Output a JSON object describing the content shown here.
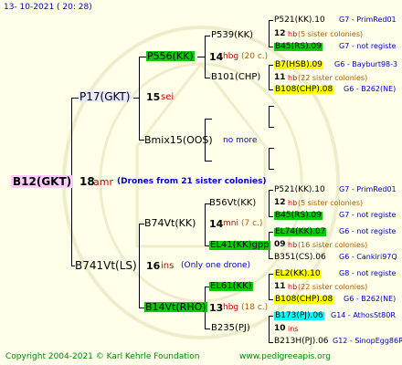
{
  "header": {
    "timestamp": "13- 10-2021 ( 20: 28)"
  },
  "footer": {
    "copyright": "Copyright 2004-2021 © Karl Kehrle Foundation",
    "site": "www.pedigreeapis.org"
  },
  "root": {
    "id": "B12(GKT)",
    "num": "18",
    "abbr": "amr",
    "note": "(Drones from 21 sister colonies)"
  },
  "p1": {
    "id": "P17(GKT)",
    "num": "15",
    "abbr": "sei"
  },
  "p2": {
    "id": "B741Vt(LS)",
    "num": "16",
    "abbr": "ins",
    "note": "(Only one drone)"
  },
  "g11": {
    "id": "P556(KK)",
    "num": "14",
    "abbr": "hbg",
    "extra": "(20 c.)"
  },
  "g12": {
    "id": "Bmix15(OOS)",
    "note": "no more"
  },
  "g21": {
    "id": "B74Vt(KK)",
    "num": "14",
    "abbr": "mni",
    "extra": "(7 c.)"
  },
  "g22": {
    "id": "B14Vt(RHO)",
    "num": "13",
    "abbr": "hbg",
    "extra": "(18 c.)"
  },
  "ggg": {
    "a": {
      "id": "P539(KK)"
    },
    "b": {
      "id": "B101(CHP)"
    },
    "c": {
      "id": "B56Vt(KK)"
    },
    "d": {
      "id": "EL41(KK)gpp",
      "num": "09",
      "abbr": "hb",
      "extra": "(16 sister colonies)"
    },
    "e": {
      "id": "EL61(KK)",
      "num": "11",
      "abbr": "hb",
      "extra": "(22 sister colonies)"
    },
    "f": {
      "id": "B235(PJ)",
      "num": "10",
      "abbr": "ins"
    }
  },
  "right": [
    {
      "id": "P521(KK).10",
      "info": "G7 - PrimRed01"
    },
    {
      "num": "12",
      "abbr": "hb",
      "extra": "(5 sister colonies)"
    },
    {
      "id": "B45(RS).09",
      "info": "G7 - not registe"
    },
    {
      "id": "B7(HSB).09",
      "info": "G6 - Bayburt98-3"
    },
    {
      "num": "11",
      "abbr": "hb",
      "extra": "(22 sister colonies)"
    },
    {
      "id": "B108(CHP).08",
      "info": "G6 - B262(NE)"
    },
    {
      "id": "P521(KK).10",
      "info": "G7 - PrimRed01"
    },
    {
      "num": "12",
      "abbr": "hb",
      "extra": "(5 sister colonies)"
    },
    {
      "id": "B45(RS).09",
      "info": "G7 - not registe"
    },
    {
      "id": "EL74(KK).07",
      "info": "G6 - not registe"
    },
    {
      "id": "B351(CS).06",
      "info": "G6 - Cankiri97Q"
    },
    {
      "id": "EL2(KK).10",
      "info": "G8 - not registe"
    },
    {
      "id": "B108(CHP).08",
      "info": "G6 - B262(NE)"
    },
    {
      "id": "B173(PJ).06",
      "info": "G14 - AthosSt80R"
    },
    {
      "id": "B213H(PJ).06",
      "info": "G12 - SinopEgg86R"
    }
  ]
}
